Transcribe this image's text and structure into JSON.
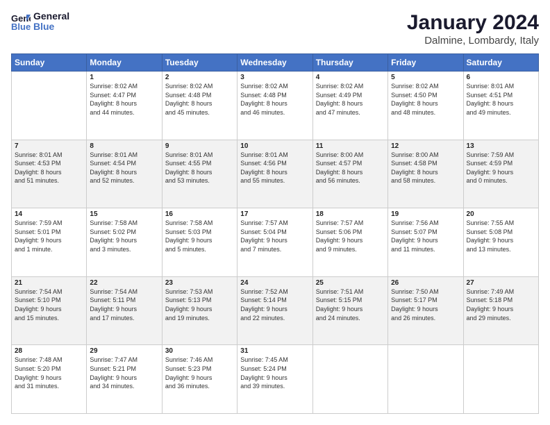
{
  "header": {
    "logo_general": "General",
    "logo_blue": "Blue",
    "title": "January 2024",
    "subtitle": "Dalmine, Lombardy, Italy"
  },
  "days_of_week": [
    "Sunday",
    "Monday",
    "Tuesday",
    "Wednesday",
    "Thursday",
    "Friday",
    "Saturday"
  ],
  "weeks": [
    [
      {
        "day": "",
        "info": ""
      },
      {
        "day": "1",
        "info": "Sunrise: 8:02 AM\nSunset: 4:47 PM\nDaylight: 8 hours\nand 44 minutes."
      },
      {
        "day": "2",
        "info": "Sunrise: 8:02 AM\nSunset: 4:48 PM\nDaylight: 8 hours\nand 45 minutes."
      },
      {
        "day": "3",
        "info": "Sunrise: 8:02 AM\nSunset: 4:48 PM\nDaylight: 8 hours\nand 46 minutes."
      },
      {
        "day": "4",
        "info": "Sunrise: 8:02 AM\nSunset: 4:49 PM\nDaylight: 8 hours\nand 47 minutes."
      },
      {
        "day": "5",
        "info": "Sunrise: 8:02 AM\nSunset: 4:50 PM\nDaylight: 8 hours\nand 48 minutes."
      },
      {
        "day": "6",
        "info": "Sunrise: 8:01 AM\nSunset: 4:51 PM\nDaylight: 8 hours\nand 49 minutes."
      }
    ],
    [
      {
        "day": "7",
        "info": "Sunrise: 8:01 AM\nSunset: 4:53 PM\nDaylight: 8 hours\nand 51 minutes."
      },
      {
        "day": "8",
        "info": "Sunrise: 8:01 AM\nSunset: 4:54 PM\nDaylight: 8 hours\nand 52 minutes."
      },
      {
        "day": "9",
        "info": "Sunrise: 8:01 AM\nSunset: 4:55 PM\nDaylight: 8 hours\nand 53 minutes."
      },
      {
        "day": "10",
        "info": "Sunrise: 8:01 AM\nSunset: 4:56 PM\nDaylight: 8 hours\nand 55 minutes."
      },
      {
        "day": "11",
        "info": "Sunrise: 8:00 AM\nSunset: 4:57 PM\nDaylight: 8 hours\nand 56 minutes."
      },
      {
        "day": "12",
        "info": "Sunrise: 8:00 AM\nSunset: 4:58 PM\nDaylight: 8 hours\nand 58 minutes."
      },
      {
        "day": "13",
        "info": "Sunrise: 7:59 AM\nSunset: 4:59 PM\nDaylight: 9 hours\nand 0 minutes."
      }
    ],
    [
      {
        "day": "14",
        "info": "Sunrise: 7:59 AM\nSunset: 5:01 PM\nDaylight: 9 hours\nand 1 minute."
      },
      {
        "day": "15",
        "info": "Sunrise: 7:58 AM\nSunset: 5:02 PM\nDaylight: 9 hours\nand 3 minutes."
      },
      {
        "day": "16",
        "info": "Sunrise: 7:58 AM\nSunset: 5:03 PM\nDaylight: 9 hours\nand 5 minutes."
      },
      {
        "day": "17",
        "info": "Sunrise: 7:57 AM\nSunset: 5:04 PM\nDaylight: 9 hours\nand 7 minutes."
      },
      {
        "day": "18",
        "info": "Sunrise: 7:57 AM\nSunset: 5:06 PM\nDaylight: 9 hours\nand 9 minutes."
      },
      {
        "day": "19",
        "info": "Sunrise: 7:56 AM\nSunset: 5:07 PM\nDaylight: 9 hours\nand 11 minutes."
      },
      {
        "day": "20",
        "info": "Sunrise: 7:55 AM\nSunset: 5:08 PM\nDaylight: 9 hours\nand 13 minutes."
      }
    ],
    [
      {
        "day": "21",
        "info": "Sunrise: 7:54 AM\nSunset: 5:10 PM\nDaylight: 9 hours\nand 15 minutes."
      },
      {
        "day": "22",
        "info": "Sunrise: 7:54 AM\nSunset: 5:11 PM\nDaylight: 9 hours\nand 17 minutes."
      },
      {
        "day": "23",
        "info": "Sunrise: 7:53 AM\nSunset: 5:13 PM\nDaylight: 9 hours\nand 19 minutes."
      },
      {
        "day": "24",
        "info": "Sunrise: 7:52 AM\nSunset: 5:14 PM\nDaylight: 9 hours\nand 22 minutes."
      },
      {
        "day": "25",
        "info": "Sunrise: 7:51 AM\nSunset: 5:15 PM\nDaylight: 9 hours\nand 24 minutes."
      },
      {
        "day": "26",
        "info": "Sunrise: 7:50 AM\nSunset: 5:17 PM\nDaylight: 9 hours\nand 26 minutes."
      },
      {
        "day": "27",
        "info": "Sunrise: 7:49 AM\nSunset: 5:18 PM\nDaylight: 9 hours\nand 29 minutes."
      }
    ],
    [
      {
        "day": "28",
        "info": "Sunrise: 7:48 AM\nSunset: 5:20 PM\nDaylight: 9 hours\nand 31 minutes."
      },
      {
        "day": "29",
        "info": "Sunrise: 7:47 AM\nSunset: 5:21 PM\nDaylight: 9 hours\nand 34 minutes."
      },
      {
        "day": "30",
        "info": "Sunrise: 7:46 AM\nSunset: 5:23 PM\nDaylight: 9 hours\nand 36 minutes."
      },
      {
        "day": "31",
        "info": "Sunrise: 7:45 AM\nSunset: 5:24 PM\nDaylight: 9 hours\nand 39 minutes."
      },
      {
        "day": "",
        "info": ""
      },
      {
        "day": "",
        "info": ""
      },
      {
        "day": "",
        "info": ""
      }
    ]
  ]
}
